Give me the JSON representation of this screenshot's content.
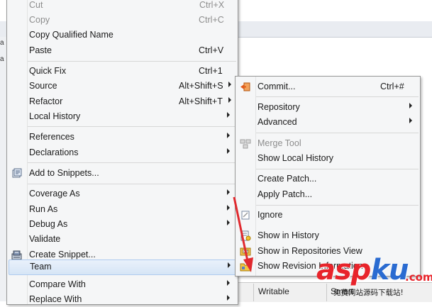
{
  "background": {
    "left_fragments": [
      "a",
      "a"
    ],
    "status_cells": [
      "Writable",
      "Smart"
    ]
  },
  "context_menu": {
    "items": [
      {
        "id": "cut",
        "label": "Cut",
        "accel": "Ctrl+X",
        "disabled": true
      },
      {
        "id": "copy",
        "label": "Copy",
        "accel": "Ctrl+C",
        "disabled": true
      },
      {
        "id": "copy-qualified-name",
        "label": "Copy Qualified Name"
      },
      {
        "id": "paste",
        "label": "Paste",
        "accel": "Ctrl+V"
      },
      {
        "id": "quick-fix",
        "label": "Quick Fix",
        "accel": "Ctrl+1"
      },
      {
        "id": "source",
        "label": "Source",
        "accel": "Alt+Shift+S",
        "submenu": true
      },
      {
        "id": "refactor",
        "label": "Refactor",
        "accel": "Alt+Shift+T",
        "submenu": true
      },
      {
        "id": "local-history",
        "label": "Local History",
        "submenu": true
      },
      {
        "id": "references",
        "label": "References",
        "submenu": true
      },
      {
        "id": "declarations",
        "label": "Declarations",
        "submenu": true
      },
      {
        "id": "add-to-snippets",
        "label": "Add to Snippets...",
        "icon": "snippet-icon"
      },
      {
        "id": "coverage-as",
        "label": "Coverage As",
        "submenu": true
      },
      {
        "id": "run-as",
        "label": "Run As",
        "submenu": true
      },
      {
        "id": "debug-as",
        "label": "Debug As",
        "submenu": true
      },
      {
        "id": "validate",
        "label": "Validate"
      },
      {
        "id": "create-snippet",
        "label": "Create Snippet...",
        "icon": "create-snippet-icon"
      },
      {
        "id": "team",
        "label": "Team",
        "submenu": true,
        "highlighted": true
      },
      {
        "id": "compare-with",
        "label": "Compare With",
        "submenu": true
      },
      {
        "id": "replace-with",
        "label": "Replace With",
        "submenu": true
      }
    ]
  },
  "team_submenu": {
    "items": [
      {
        "id": "commit",
        "label": "Commit...",
        "accel": "Ctrl+#",
        "icon": "commit-icon"
      },
      {
        "id": "repository",
        "label": "Repository",
        "submenu": true
      },
      {
        "id": "advanced",
        "label": "Advanced",
        "submenu": true
      },
      {
        "id": "merge-tool",
        "label": "Merge Tool",
        "disabled": true,
        "icon": "merge-icon"
      },
      {
        "id": "show-local-history",
        "label": "Show Local History"
      },
      {
        "id": "create-patch",
        "label": "Create Patch..."
      },
      {
        "id": "apply-patch",
        "label": "Apply Patch..."
      },
      {
        "id": "ignore",
        "label": "Ignore",
        "icon": "ignore-icon"
      },
      {
        "id": "show-in-history",
        "label": "Show in History",
        "icon": "history-icon"
      },
      {
        "id": "show-in-repositories-view",
        "label": "Show in Repositories View",
        "icon": "repositories-icon"
      },
      {
        "id": "show-revision-information",
        "label": "Show Revision Information",
        "icon": "revision-icon"
      }
    ]
  },
  "watermark": {
    "brand_a": "asp",
    "brand_b": "ku",
    "dotcom": ".com",
    "tagline": "免费网站源码下载站!"
  }
}
